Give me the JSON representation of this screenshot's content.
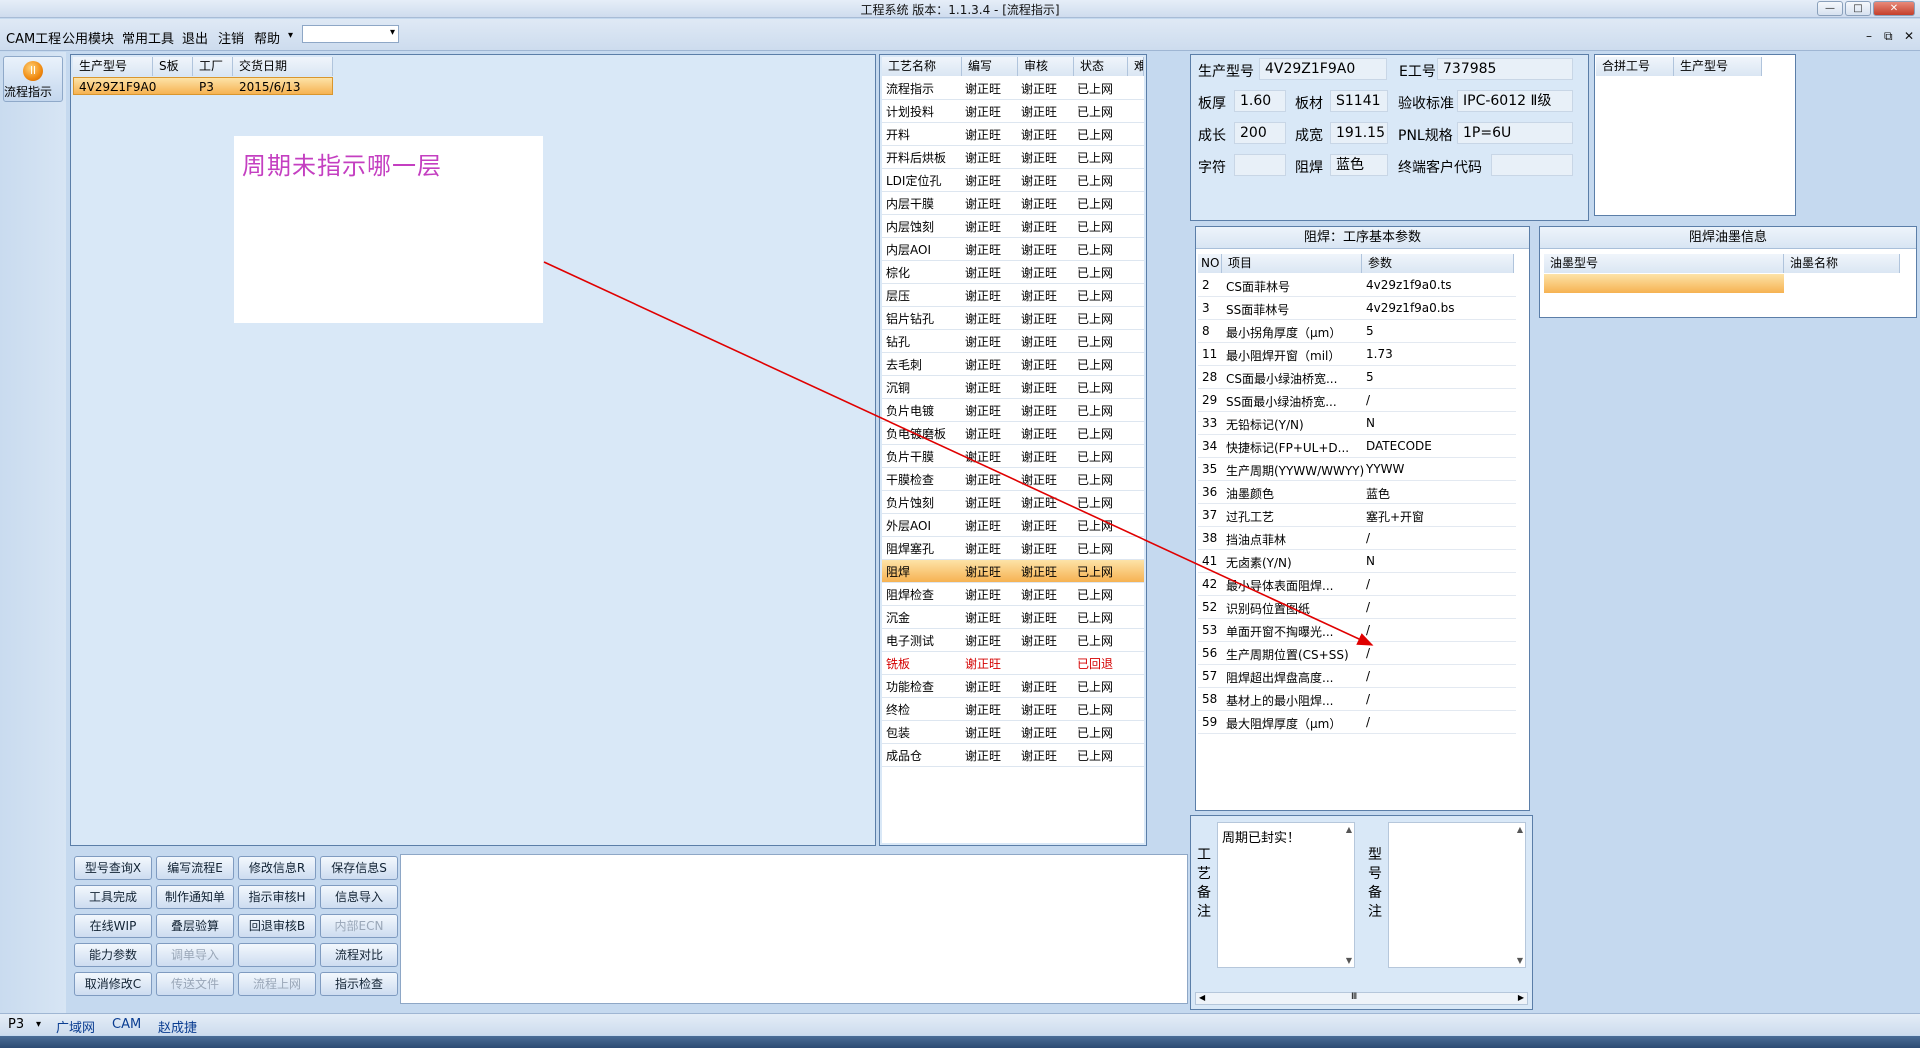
{
  "window": {
    "faded_text": "",
    "title": "工程系统    版本：1.1.3.4 - [流程指示]",
    "min": "—",
    "max": "□",
    "close": "✕"
  },
  "menu": {
    "items": [
      "CAM工程",
      "公用模块",
      "常用工具",
      "退出",
      "注销",
      "帮助"
    ],
    "help_arrow": "▾",
    "combo_arrow": "▾",
    "mdi": [
      "–",
      "⧉",
      "✕"
    ]
  },
  "rail": {
    "button_label": "流程指示"
  },
  "order_grid": {
    "headers": [
      "生产型号",
      "S板",
      "工厂",
      "交货日期"
    ],
    "row": [
      "4V29Z1F9A0",
      "",
      "P3",
      "2015/6/13"
    ]
  },
  "note": {
    "text": "周期未指示哪一层"
  },
  "process_grid": {
    "headers": [
      "工艺名称",
      "编写",
      "审核",
      "状态",
      "难度"
    ],
    "rows": [
      [
        "流程指示",
        "谢正旺",
        "谢正旺",
        "已上网"
      ],
      [
        "计划投料",
        "谢正旺",
        "谢正旺",
        "已上网"
      ],
      [
        "开料",
        "谢正旺",
        "谢正旺",
        "已上网"
      ],
      [
        "开料后烘板",
        "谢正旺",
        "谢正旺",
        "已上网"
      ],
      [
        "LDI定位孔",
        "谢正旺",
        "谢正旺",
        "已上网"
      ],
      [
        "内层干膜",
        "谢正旺",
        "谢正旺",
        "已上网"
      ],
      [
        "内层蚀刻",
        "谢正旺",
        "谢正旺",
        "已上网"
      ],
      [
        "内层AOI",
        "谢正旺",
        "谢正旺",
        "已上网"
      ],
      [
        "棕化",
        "谢正旺",
        "谢正旺",
        "已上网"
      ],
      [
        "层压",
        "谢正旺",
        "谢正旺",
        "已上网"
      ],
      [
        "铝片钻孔",
        "谢正旺",
        "谢正旺",
        "已上网"
      ],
      [
        "钻孔",
        "谢正旺",
        "谢正旺",
        "已上网"
      ],
      [
        "去毛刺",
        "谢正旺",
        "谢正旺",
        "已上网"
      ],
      [
        "沉铜",
        "谢正旺",
        "谢正旺",
        "已上网"
      ],
      [
        "负片电镀",
        "谢正旺",
        "谢正旺",
        "已上网"
      ],
      [
        "负电镀磨板",
        "谢正旺",
        "谢正旺",
        "已上网"
      ],
      [
        "负片干膜",
        "谢正旺",
        "谢正旺",
        "已上网"
      ],
      [
        "干膜检查",
        "谢正旺",
        "谢正旺",
        "已上网"
      ],
      [
        "负片蚀刻",
        "谢正旺",
        "谢正旺",
        "已上网"
      ],
      [
        "外层AOI",
        "谢正旺",
        "谢正旺",
        "已上网"
      ],
      [
        "阻焊塞孔",
        "谢正旺",
        "谢正旺",
        "已上网"
      ],
      [
        "阻焊",
        "谢正旺",
        "谢正旺",
        "已上网"
      ],
      [
        "阻焊检查",
        "谢正旺",
        "谢正旺",
        "已上网"
      ],
      [
        "沉金",
        "谢正旺",
        "谢正旺",
        "已上网"
      ],
      [
        "电子测试",
        "谢正旺",
        "谢正旺",
        "已上网"
      ],
      [
        "铣板",
        "谢正旺",
        "",
        "已回退"
      ],
      [
        "功能检查",
        "谢正旺",
        "谢正旺",
        "已上网"
      ],
      [
        "终检",
        "谢正旺",
        "谢正旺",
        "已上网"
      ],
      [
        "包装",
        "谢正旺",
        "谢正旺",
        "已上网"
      ],
      [
        "成品仓",
        "谢正旺",
        "谢正旺",
        "已上网"
      ]
    ],
    "selected_index": 21,
    "returned_index": 25
  },
  "info": {
    "model_label": "生产型号",
    "model_value": "4V29Z1F9A0",
    "eno_label": "E工号",
    "eno_value": "737985",
    "thick_label": "板厚",
    "thick_value": "1.60",
    "material_label": "板材",
    "material_value": "S1141",
    "accept_label": "验收标准",
    "accept_value": "IPC-6012 Ⅱ级",
    "len_label": "成长",
    "len_value": "200",
    "width_label": "成宽",
    "width_value": "191.15",
    "pnl_label": "PNL规格",
    "pnl_value": "1P=6U",
    "char_label": "字符",
    "char_value": "",
    "mask_label": "阻焊",
    "mask_value": "蓝色",
    "customer_label": "终端客户代码",
    "customer_value": ""
  },
  "merge": {
    "headers": [
      "合拼工号",
      "生产型号"
    ]
  },
  "params": {
    "title": "阻焊：工序基本参数",
    "headers": [
      "NO",
      "项目",
      "参数"
    ],
    "rows": [
      [
        "2",
        "CS面菲林号",
        "4v29z1f9a0.ts"
      ],
      [
        "3",
        "SS面菲林号",
        "4v29z1f9a0.bs"
      ],
      [
        "8",
        "最小拐角厚度（μm）",
        "5"
      ],
      [
        "11",
        "最小阻焊开窗（mil）",
        "1.73"
      ],
      [
        "28",
        "CS面最小绿油桥宽...",
        "5"
      ],
      [
        "29",
        "SS面最小绿油桥宽...",
        "/"
      ],
      [
        "33",
        "无铅标记(Y/N)",
        "N"
      ],
      [
        "34",
        "快捷标记(FP+UL+D...",
        "DATECODE"
      ],
      [
        "35",
        "生产周期(YYWW/WWYY)",
        "YYWW"
      ],
      [
        "36",
        "油墨颜色",
        "蓝色"
      ],
      [
        "37",
        "过孔工艺",
        "塞孔+开窗"
      ],
      [
        "38",
        "挡油点菲林",
        "/"
      ],
      [
        "41",
        "无卤素(Y/N)",
        "N"
      ],
      [
        "42",
        "最小导体表面阻焊...",
        "/"
      ],
      [
        "52",
        "识别码位置图纸",
        "/"
      ],
      [
        "53",
        "单面开窗不掏曝光...",
        "/"
      ],
      [
        "56",
        "生产周期位置(CS+SS)",
        "/"
      ],
      [
        "57",
        "阻焊超出焊盘高度...",
        "/"
      ],
      [
        "58",
        "基材上的最小阻焊...",
        "/"
      ],
      [
        "59",
        "最大阻焊厚度（μm）",
        "/"
      ]
    ]
  },
  "ink": {
    "title": "阻焊油墨信息",
    "headers": [
      "油墨型号",
      "油墨名称"
    ]
  },
  "remarks": {
    "process_label": [
      "工",
      "艺",
      "备",
      "注"
    ],
    "process_text": "周期已封实！",
    "model_label": [
      "型",
      "号",
      "备",
      "注"
    ],
    "scroll_up": "▲",
    "scroll_down": "▼",
    "scroll_left": "◀",
    "scroll_right": "▶",
    "grip": "Ⅲ"
  },
  "buttons": [
    [
      {
        "label": "型号查询X",
        "enabled": true
      },
      {
        "label": "编写流程E",
        "enabled": true
      },
      {
        "label": "修改信息R",
        "enabled": true
      },
      {
        "label": "保存信息S",
        "enabled": true
      }
    ],
    [
      {
        "label": "工具完成",
        "enabled": true
      },
      {
        "label": "制作通知单",
        "enabled": true
      },
      {
        "label": "指示审核H",
        "enabled": true
      },
      {
        "label": "信息导入",
        "enabled": true
      }
    ],
    [
      {
        "label": "在线WIP",
        "enabled": true
      },
      {
        "label": "叠层验算",
        "enabled": true
      },
      {
        "label": "回退审核B",
        "enabled": true
      },
      {
        "label": "内部ECN",
        "enabled": false
      }
    ],
    [
      {
        "label": "能力参数",
        "enabled": true
      },
      {
        "label": "调单导入",
        "enabled": false
      },
      {
        "label": "",
        "enabled": false
      },
      {
        "label": "流程对比",
        "enabled": true
      }
    ],
    [
      {
        "label": "取消修改C",
        "enabled": true
      },
      {
        "label": "传送文件",
        "enabled": false
      },
      {
        "label": "流程上网",
        "enabled": false
      },
      {
        "label": "指示检查",
        "enabled": true
      }
    ]
  ],
  "status": {
    "factory": "P3",
    "arrow": "▾",
    "net": "广域网",
    "module": "CAM",
    "user": "赵成捷"
  },
  "colors": {
    "returned": "#d40000",
    "annotation_arrow": "#e00000",
    "note_text": "#c43fc1"
  }
}
